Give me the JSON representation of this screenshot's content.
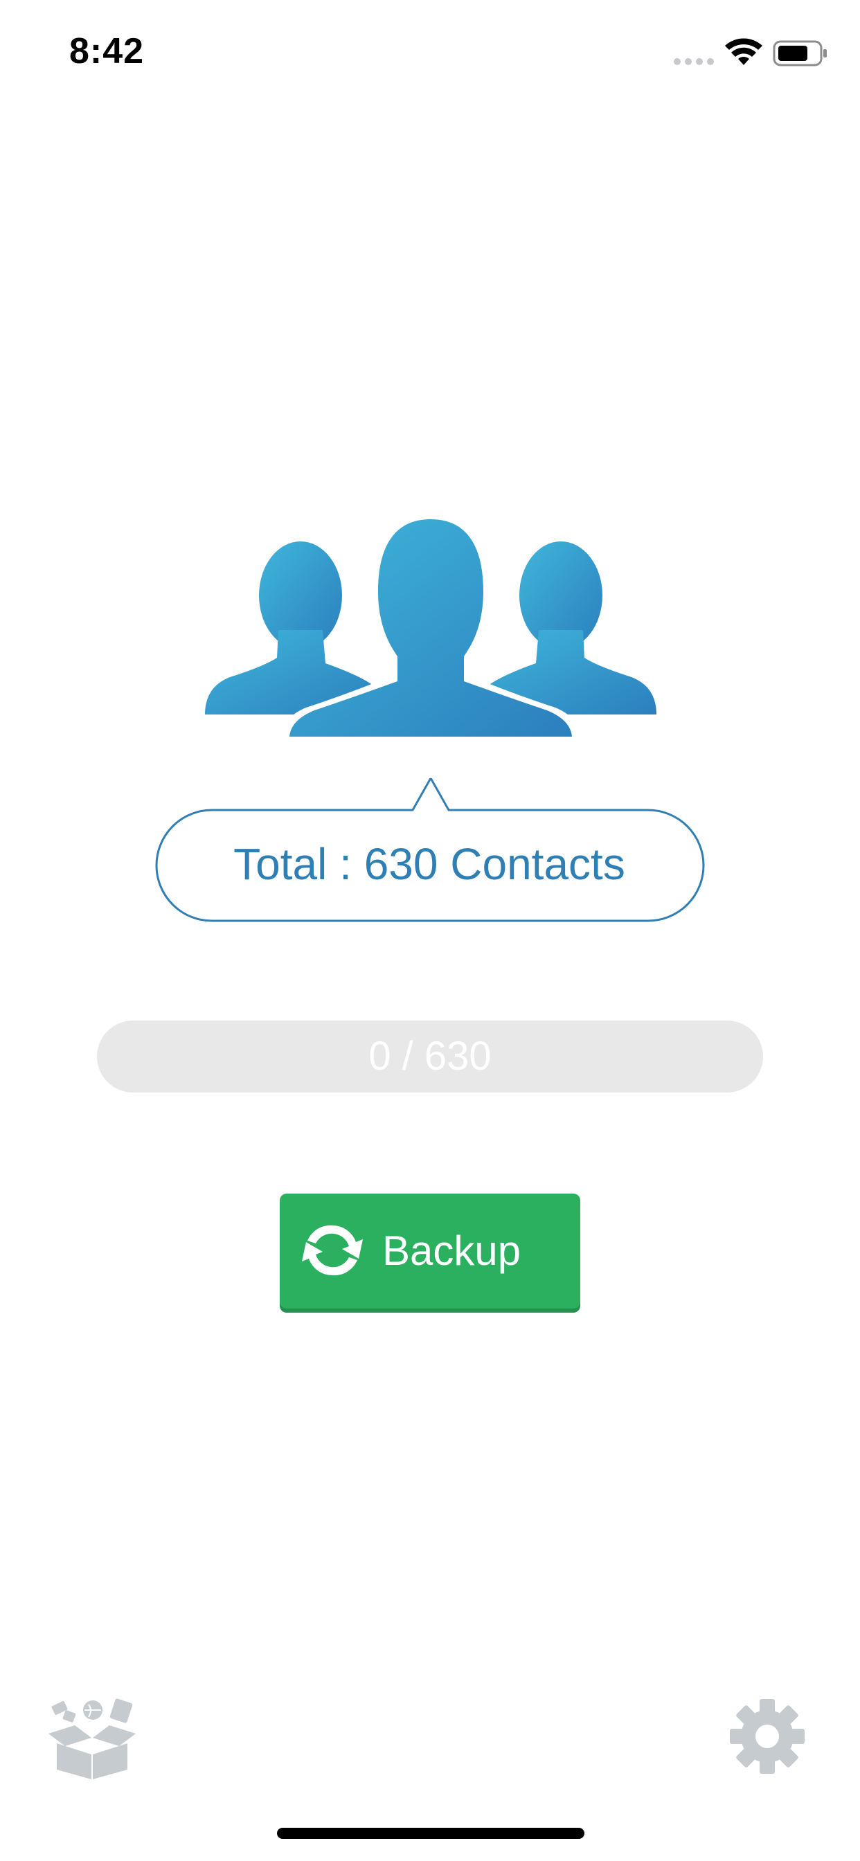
{
  "status_bar": {
    "time": "8:42"
  },
  "summary": {
    "total_label": "Total : 630 Contacts"
  },
  "progress": {
    "label": "0 / 630",
    "value": 0,
    "total": 630
  },
  "backup_button": {
    "label": "Backup",
    "icon": "refresh-icon"
  },
  "bottom_bar": {
    "left_icon": "box-icon",
    "right_icon": "gear-icon"
  },
  "colors": {
    "accent_blue": "#2f7fb5",
    "illustration_light": "#3fb6db",
    "illustration_dark": "#2c7fbd",
    "button_green": "#2bb05f",
    "progress_track": "#e8e8e8",
    "icon_gray": "#c6cbd0"
  }
}
